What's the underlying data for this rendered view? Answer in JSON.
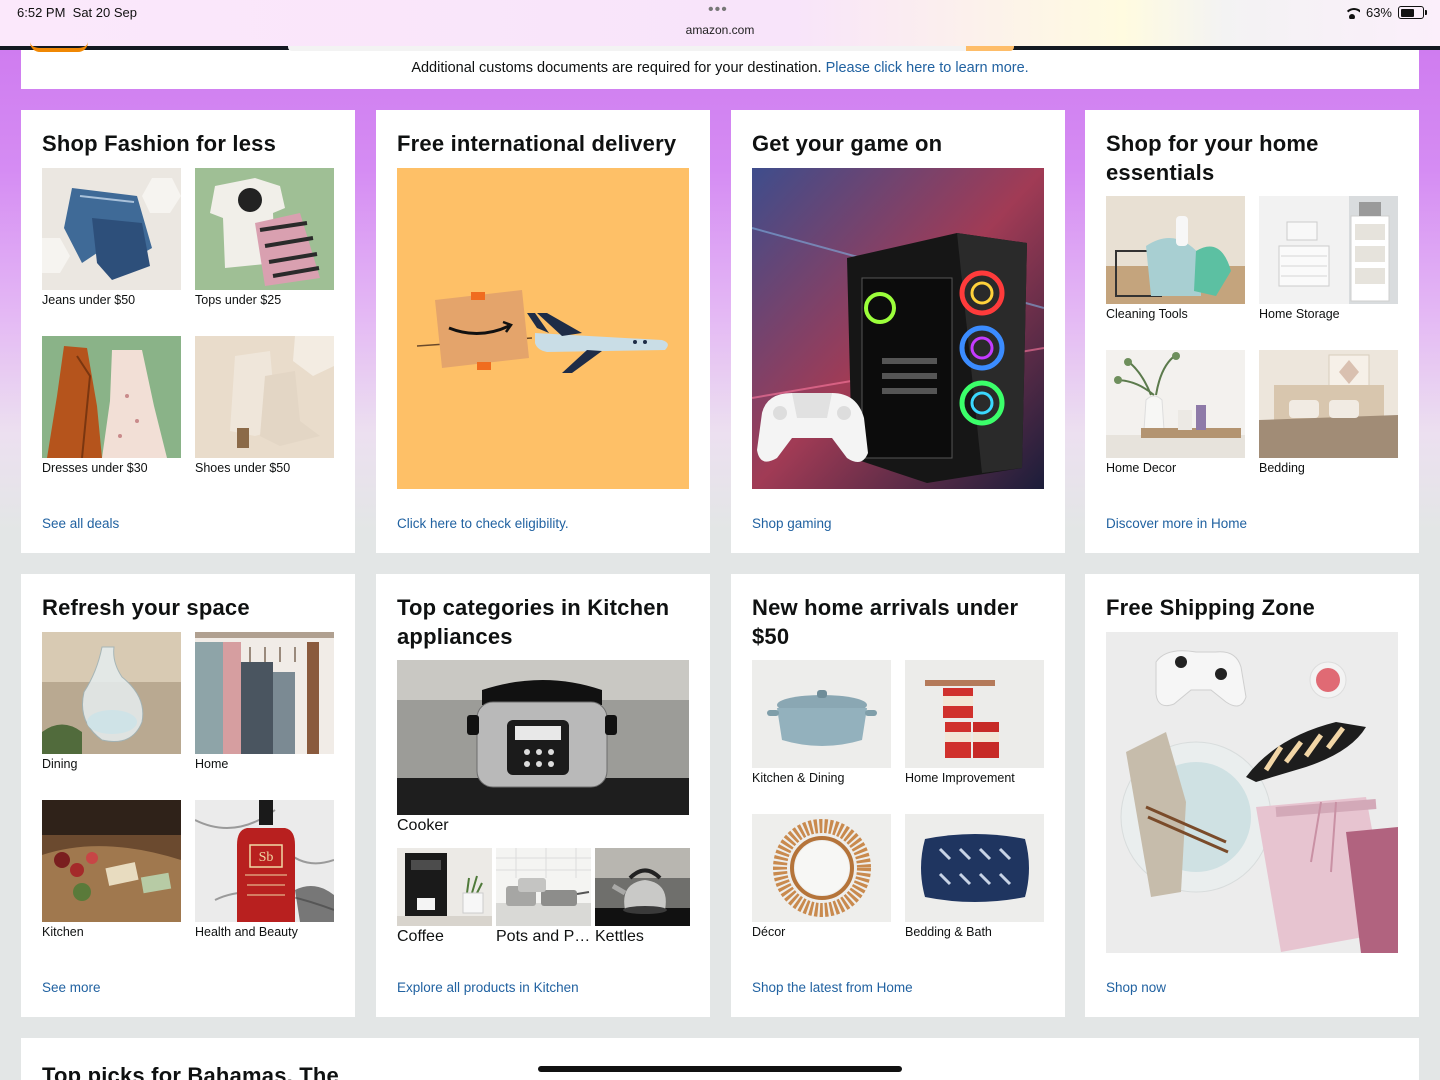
{
  "status_bar": {
    "time": "6:52 PM",
    "date": "Sat 20 Sep",
    "url": "amazon.com",
    "battery": "63%",
    "dots": "•••"
  },
  "notice": {
    "text": "Additional customs documents are required for your destination.",
    "link": "Please click here to learn more."
  },
  "cards": {
    "fashion": {
      "title": "Shop Fashion for less",
      "items": [
        "Jeans under $50",
        "Tops under $25",
        "Dresses under $30",
        "Shoes under $50"
      ],
      "link": "See all deals"
    },
    "delivery": {
      "title": "Free international delivery",
      "link": "Click here to check eligibility."
    },
    "gaming": {
      "title": "Get your game on",
      "link": "Shop gaming"
    },
    "home_essentials": {
      "title": "Shop for your home essentials",
      "items": [
        "Cleaning Tools",
        "Home Storage",
        "Home Decor",
        "Bedding"
      ],
      "link": "Discover more in Home"
    },
    "refresh": {
      "title": "Refresh your space",
      "items": [
        "Dining",
        "Home",
        "Kitchen",
        "Health and Beauty"
      ],
      "link": "See more"
    },
    "kitchen": {
      "title": "Top categories in Kitchen appliances",
      "main": "Cooker",
      "items": [
        "Coffee",
        "Pots and P…",
        "Kettles"
      ],
      "link": "Explore all products in Kitchen"
    },
    "arrivals": {
      "title": "New home arrivals under $50",
      "items": [
        "Kitchen & Dining",
        "Home Improvement",
        "Décor",
        "Bedding & Bath"
      ],
      "link": "Shop the latest from Home"
    },
    "shipping": {
      "title": "Free Shipping Zone",
      "link": "Shop now"
    },
    "top_picks": {
      "title": "Top picks for Bahamas, The"
    }
  },
  "colors": {
    "link": "#2162a1",
    "nav": "#131921",
    "accent": "#f08804"
  }
}
